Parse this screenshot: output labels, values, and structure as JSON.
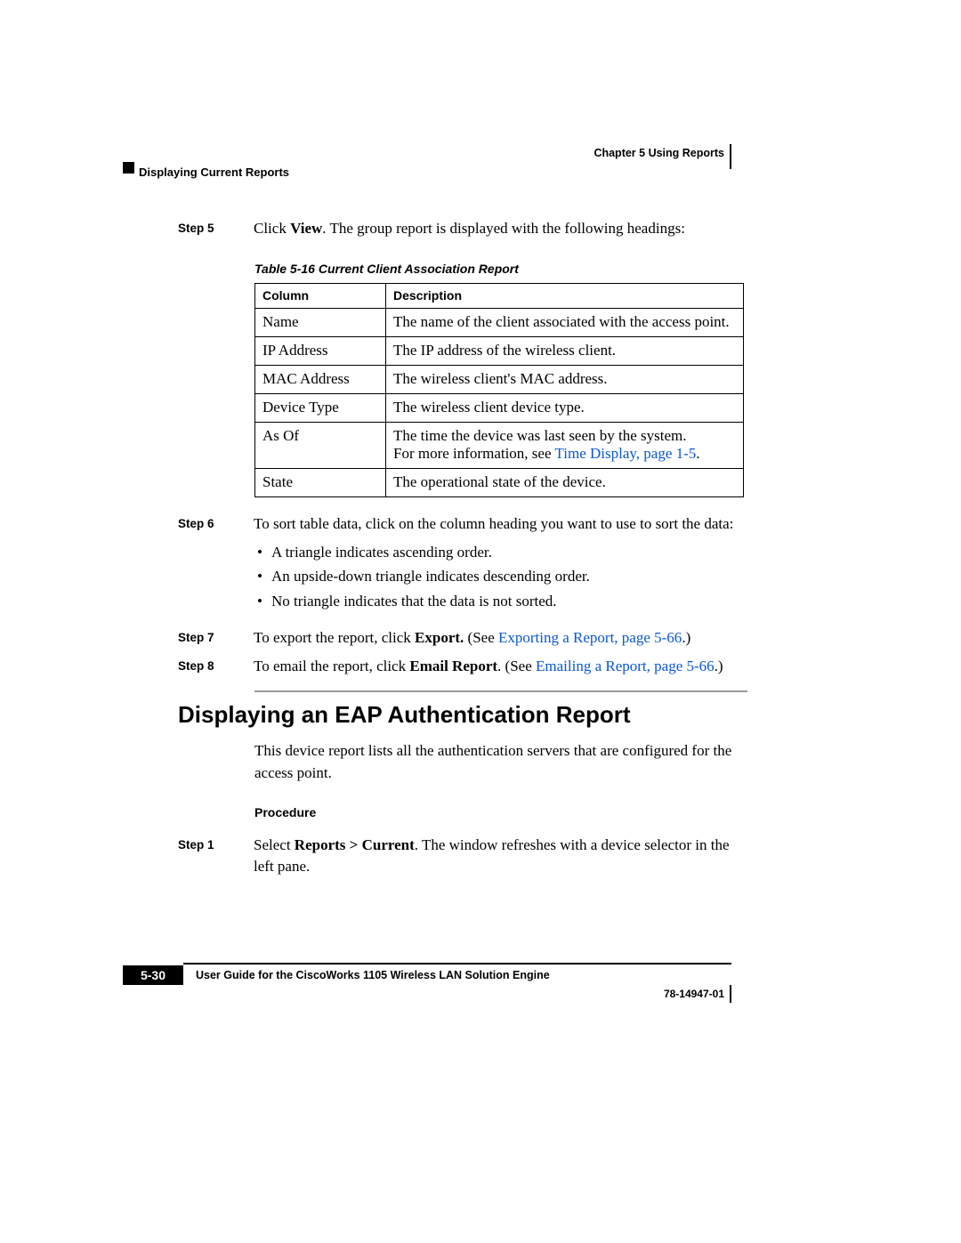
{
  "header": {
    "chapter_line": "Chapter 5      Using Reports",
    "section": "Displaying Current Reports"
  },
  "step5": {
    "label": "Step 5",
    "pre": "Click ",
    "bold": "View",
    "post": ". The group report is displayed with the following headings:"
  },
  "table": {
    "caption": "Table 5-16    Current Client Association Report",
    "head_col": "Column",
    "head_desc": "Description",
    "rows": [
      {
        "col": "Name",
        "desc": "The name of the client associated with the access point."
      },
      {
        "col": "IP Address",
        "desc": "The IP address of the wireless client."
      },
      {
        "col": "MAC Address",
        "desc": "The wireless client's MAC address."
      },
      {
        "col": "Device Type",
        "desc": "The wireless client device type."
      }
    ],
    "asof_col": "As Of",
    "asof_line1": "The time the device was last seen by the system.",
    "asof_line2_pre": "For more information, see ",
    "asof_link": "Time Display, page 1-5",
    "asof_line2_post": ".",
    "state_col": "State",
    "state_desc": "The operational state of the device."
  },
  "step6": {
    "label": "Step 6",
    "text": "To sort table data, click on the column heading you want to use to sort the data:",
    "bullets": [
      "A triangle indicates ascending order.",
      "An upside-down triangle indicates descending order.",
      "No triangle indicates that the data is not sorted."
    ]
  },
  "step7": {
    "label": "Step 7",
    "pre": "To export the report, click ",
    "bold": "Export.",
    "mid": " (See ",
    "link": "Exporting a Report, page 5-66",
    "post": ".)"
  },
  "step8": {
    "label": "Step 8",
    "pre": "To email the report, click ",
    "bold": "Email Report",
    "mid": ". (See ",
    "link": "Emailing a Report, page 5-66",
    "post": ".)"
  },
  "eap_heading": "Displaying an EAP Authentication Report",
  "body2": {
    "intro": "This device report lists all the authentication servers that are configured for the access point.",
    "proc_label": "Procedure"
  },
  "step1b": {
    "label": "Step 1",
    "pre": "Select ",
    "bold": "Reports > Current",
    "post": ". The window refreshes with a device selector in the left pane."
  },
  "footer": {
    "guide_title": "User Guide for the CiscoWorks 1105 Wireless LAN Solution Engine",
    "page_num": "5-30",
    "pub_num": "78-14947-01"
  }
}
